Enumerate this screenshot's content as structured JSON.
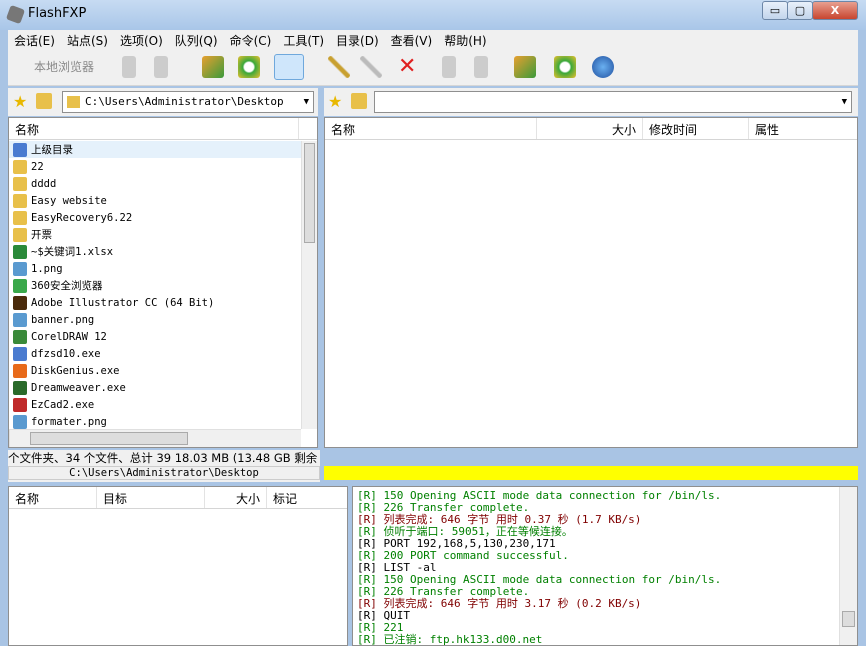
{
  "window": {
    "title": "FlashFXP",
    "min": "▭",
    "max": "▢",
    "close": "X"
  },
  "menu": [
    "会话(E)",
    "站点(S)",
    "选项(O)",
    "队列(Q)",
    "命令(C)",
    "工具(T)",
    "目录(D)",
    "查看(V)",
    "帮助(H)"
  ],
  "toolbar": {
    "local_browser": "本地浏览器"
  },
  "left": {
    "path": "C:\\Users\\Administrator\\Desktop",
    "column": "名称",
    "files": [
      {
        "name": "上级目录",
        "icon": "up-folder-icon",
        "color": "#4a7bd0"
      },
      {
        "name": "22",
        "icon": "folder-icon",
        "color": "#e8c04a"
      },
      {
        "name": "dddd",
        "icon": "folder-icon",
        "color": "#e8c04a"
      },
      {
        "name": "Easy website",
        "icon": "folder-icon",
        "color": "#e8c04a"
      },
      {
        "name": "EasyRecovery6.22",
        "icon": "folder-icon",
        "color": "#e8c04a"
      },
      {
        "name": "开票",
        "icon": "folder-icon",
        "color": "#e8c04a"
      },
      {
        "name": "~$关键词1.xlsx",
        "icon": "excel-icon",
        "color": "#2a8a3a"
      },
      {
        "name": "1.png",
        "icon": "png-icon",
        "color": "#5a9ad0"
      },
      {
        "name": "360安全浏览器",
        "icon": "browser-icon",
        "color": "#3aa84a"
      },
      {
        "name": "Adobe Illustrator CC (64 Bit)",
        "icon": "illustrator-icon",
        "color": "#4a2a0a"
      },
      {
        "name": "banner.png",
        "icon": "png-icon",
        "color": "#5a9ad0"
      },
      {
        "name": "CorelDRAW 12",
        "icon": "coreldraw-icon",
        "color": "#3a8a3a"
      },
      {
        "name": "dfzsd10.exe",
        "icon": "exe-icon",
        "color": "#4a7bd0"
      },
      {
        "name": "DiskGenius.exe",
        "icon": "diskgenius-icon",
        "color": "#e86a1a"
      },
      {
        "name": "Dreamweaver.exe",
        "icon": "dreamweaver-icon",
        "color": "#2a6a2a"
      },
      {
        "name": "EzCad2.exe",
        "icon": "exe-icon",
        "color": "#c02a2a"
      },
      {
        "name": "formater.png",
        "icon": "png-icon",
        "color": "#5a9ad0"
      }
    ],
    "status": "个文件夹、34 个文件、总计 39 18.03 MB (13.48 GB 剩余",
    "status_path": "C:\\Users\\Administrator\\Desktop"
  },
  "right": {
    "path": "",
    "columns": [
      "名称",
      "大小",
      "修改时间",
      "属性"
    ],
    "status_color": "#ffff00"
  },
  "queue": {
    "columns": [
      "名称",
      "目标",
      "大小",
      "标记"
    ]
  },
  "log": [
    {
      "t": "[R] 150 Opening ASCII mode data connection for /bin/ls.",
      "c": "g"
    },
    {
      "t": "[R] 226 Transfer complete.",
      "c": "g"
    },
    {
      "t": "[R] 列表完成: 646 字节 用时 0.37 秒 (1.7 KB/s)",
      "c": "r"
    },
    {
      "t": "[R] 侦听于端口: 59051，正在等候连接。",
      "c": "g"
    },
    {
      "t": "[R] PORT 192,168,5,130,230,171",
      "c": "k"
    },
    {
      "t": "[R] 200 PORT command successful.",
      "c": "g"
    },
    {
      "t": "[R] LIST -al",
      "c": "k"
    },
    {
      "t": "[R] 150 Opening ASCII mode data connection for /bin/ls.",
      "c": "g"
    },
    {
      "t": "[R] 226 Transfer complete.",
      "c": "g"
    },
    {
      "t": "[R] 列表完成: 646 字节 用时 3.17 秒 (0.2 KB/s)",
      "c": "r"
    },
    {
      "t": "[R] QUIT",
      "c": "k"
    },
    {
      "t": "[R] 221",
      "c": "g"
    },
    {
      "t": "[R] 已注销: ftp.hk133.d00.net",
      "c": "g"
    }
  ]
}
